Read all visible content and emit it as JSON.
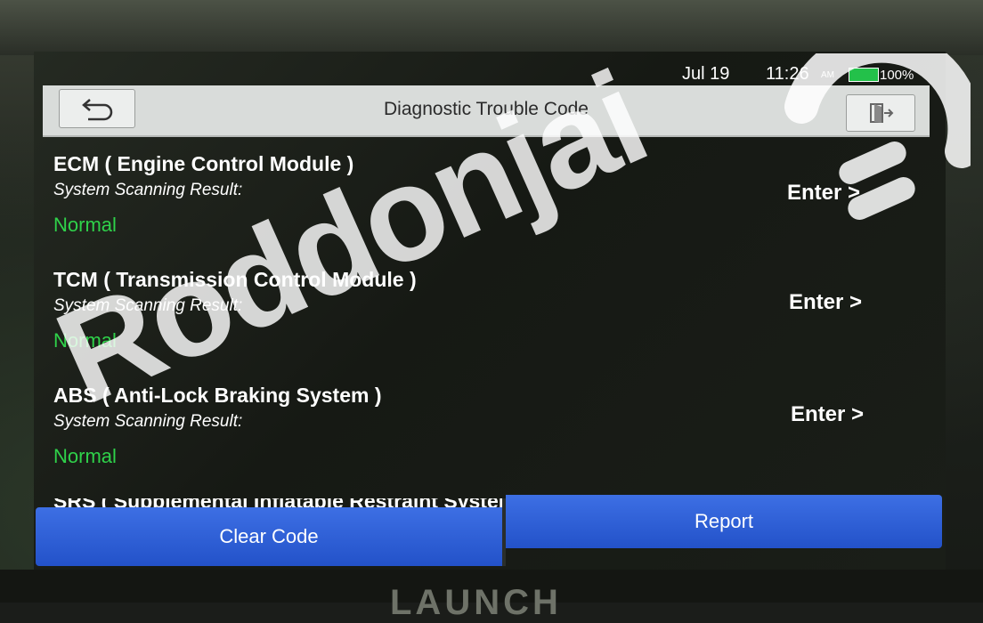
{
  "status_bar": {
    "date": "Jul 19",
    "time": "11:26",
    "ampm": "AM",
    "battery": "100%"
  },
  "header": {
    "title": "Diagnostic Trouble Code",
    "back_icon": "back-arrow-icon",
    "exit_icon": "exit-door-icon"
  },
  "modules": [
    {
      "name": "ECM ( Engine Control Module )",
      "scan_label": "System Scanning Result:",
      "status": "Normal",
      "enter_label": "Enter >"
    },
    {
      "name": "TCM ( Transmission Control Module )",
      "scan_label": "System Scanning Result:",
      "status": "Normal",
      "enter_label": "Enter >"
    },
    {
      "name": "ABS ( Anti-Lock Braking System )",
      "scan_label": "System Scanning Result:",
      "status": "Normal",
      "enter_label": "Enter >"
    },
    {
      "name": "SRS ( Supplemental Inflatable Restraint System )"
    }
  ],
  "footer": {
    "clear_label": "Clear Code",
    "report_label": "Report"
  },
  "device": {
    "brand": "LAUNCH"
  },
  "watermark": {
    "text": "Roddonjai"
  },
  "colors": {
    "status_normal": "#2fd24a",
    "button_blue": "#2d5fd8",
    "title_bar": "#d9dcda"
  }
}
